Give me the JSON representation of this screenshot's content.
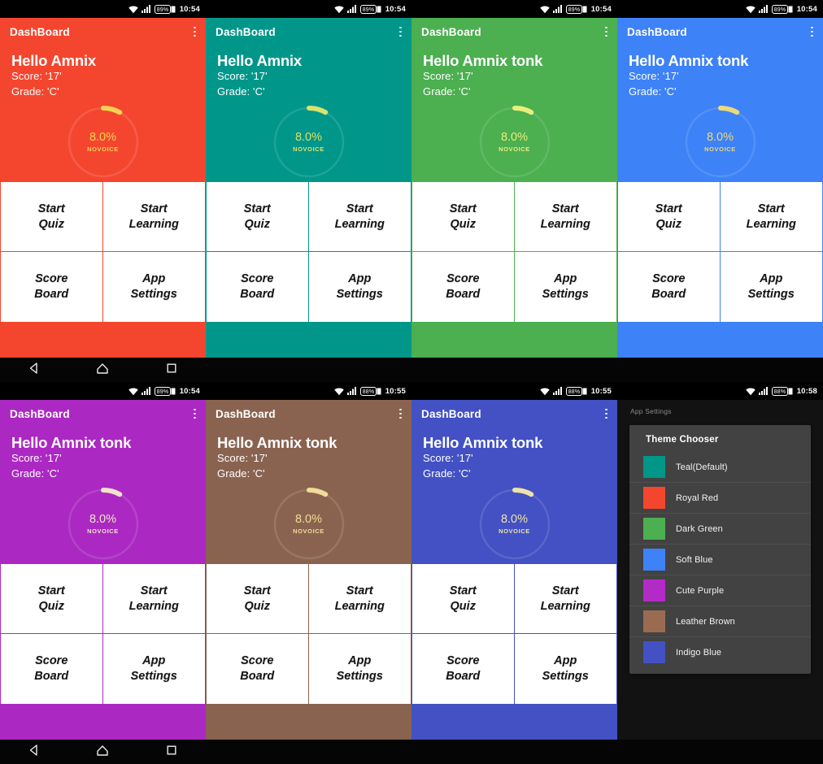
{
  "app": {
    "appbar_title": "DashBoard",
    "menu_icon": "kebab-menu-icon"
  },
  "dashboard": {
    "score_line": "Score: '17'",
    "grade_line": "Grade: 'C'",
    "ring_percent": "8.0%",
    "ring_label": "NOVOICE",
    "ring_value": 8.0,
    "buttons": [
      "Start\nQuiz",
      "Start\nLearning",
      "Score\nBoard",
      "App\nSettings"
    ]
  },
  "status_bar": {
    "wifi_icon": "wifi-icon",
    "signal_icon": "cellular-signal-icon",
    "battery_icon": "battery-icon"
  },
  "nav_bar": {
    "back_icon": "back-triangle-icon",
    "home_icon": "home-pentagon-icon",
    "recents_icon": "recents-square-icon"
  },
  "screens": [
    {
      "id": "royal-red",
      "theme_color": "#f4462f",
      "greeting": "Hello Amnix",
      "battery": "89%",
      "time": "10:54",
      "ring_text_color": "#f6d154"
    },
    {
      "id": "teal",
      "theme_color": "#00968a",
      "greeting": "Hello Amnix",
      "battery": "89%",
      "time": "10:54",
      "ring_text_color": "#d9e36a"
    },
    {
      "id": "dark-green",
      "theme_color": "#4caf50",
      "greeting": "Hello Amnix tonk",
      "battery": "89%",
      "time": "10:54",
      "ring_text_color": "#e8ef7a"
    },
    {
      "id": "soft-blue",
      "theme_color": "#3d82f7",
      "greeting": "Hello Amnix tonk",
      "battery": "89%",
      "time": "10:54",
      "ring_text_color": "#ecd97a"
    },
    {
      "id": "cute-purple",
      "theme_color": "#ab29c2",
      "greeting": "Hello Amnix tonk",
      "battery": "89%",
      "time": "10:54",
      "ring_text_color": "#f0e4c8"
    },
    {
      "id": "leather-brown",
      "theme_color": "#8a6350",
      "greeting": "Hello Amnix tonk",
      "battery": "88%",
      "time": "10:55",
      "ring_text_color": "#f0dc9a"
    },
    {
      "id": "indigo-blue",
      "theme_color": "#4351c4",
      "greeting": "Hello Amnix tonk",
      "battery": "88%",
      "time": "10:55",
      "ring_text_color": "#ece4a8"
    }
  ],
  "settings_screen": {
    "page_title": "App Settings",
    "battery": "88%",
    "time": "10:58",
    "dialog_title": "Theme Chooser",
    "themes": [
      {
        "label": "Teal(Default)",
        "color": "#009688"
      },
      {
        "label": "Royal Red",
        "color": "#f4462f"
      },
      {
        "label": "Dark Green",
        "color": "#4caf50"
      },
      {
        "label": "Soft Blue",
        "color": "#3d82f7"
      },
      {
        "label": "Cute Purple",
        "color": "#b32bc7"
      },
      {
        "label": "Leather Brown",
        "color": "#9a6b51"
      },
      {
        "label": "Indigo Blue",
        "color": "#4351c4"
      }
    ]
  }
}
